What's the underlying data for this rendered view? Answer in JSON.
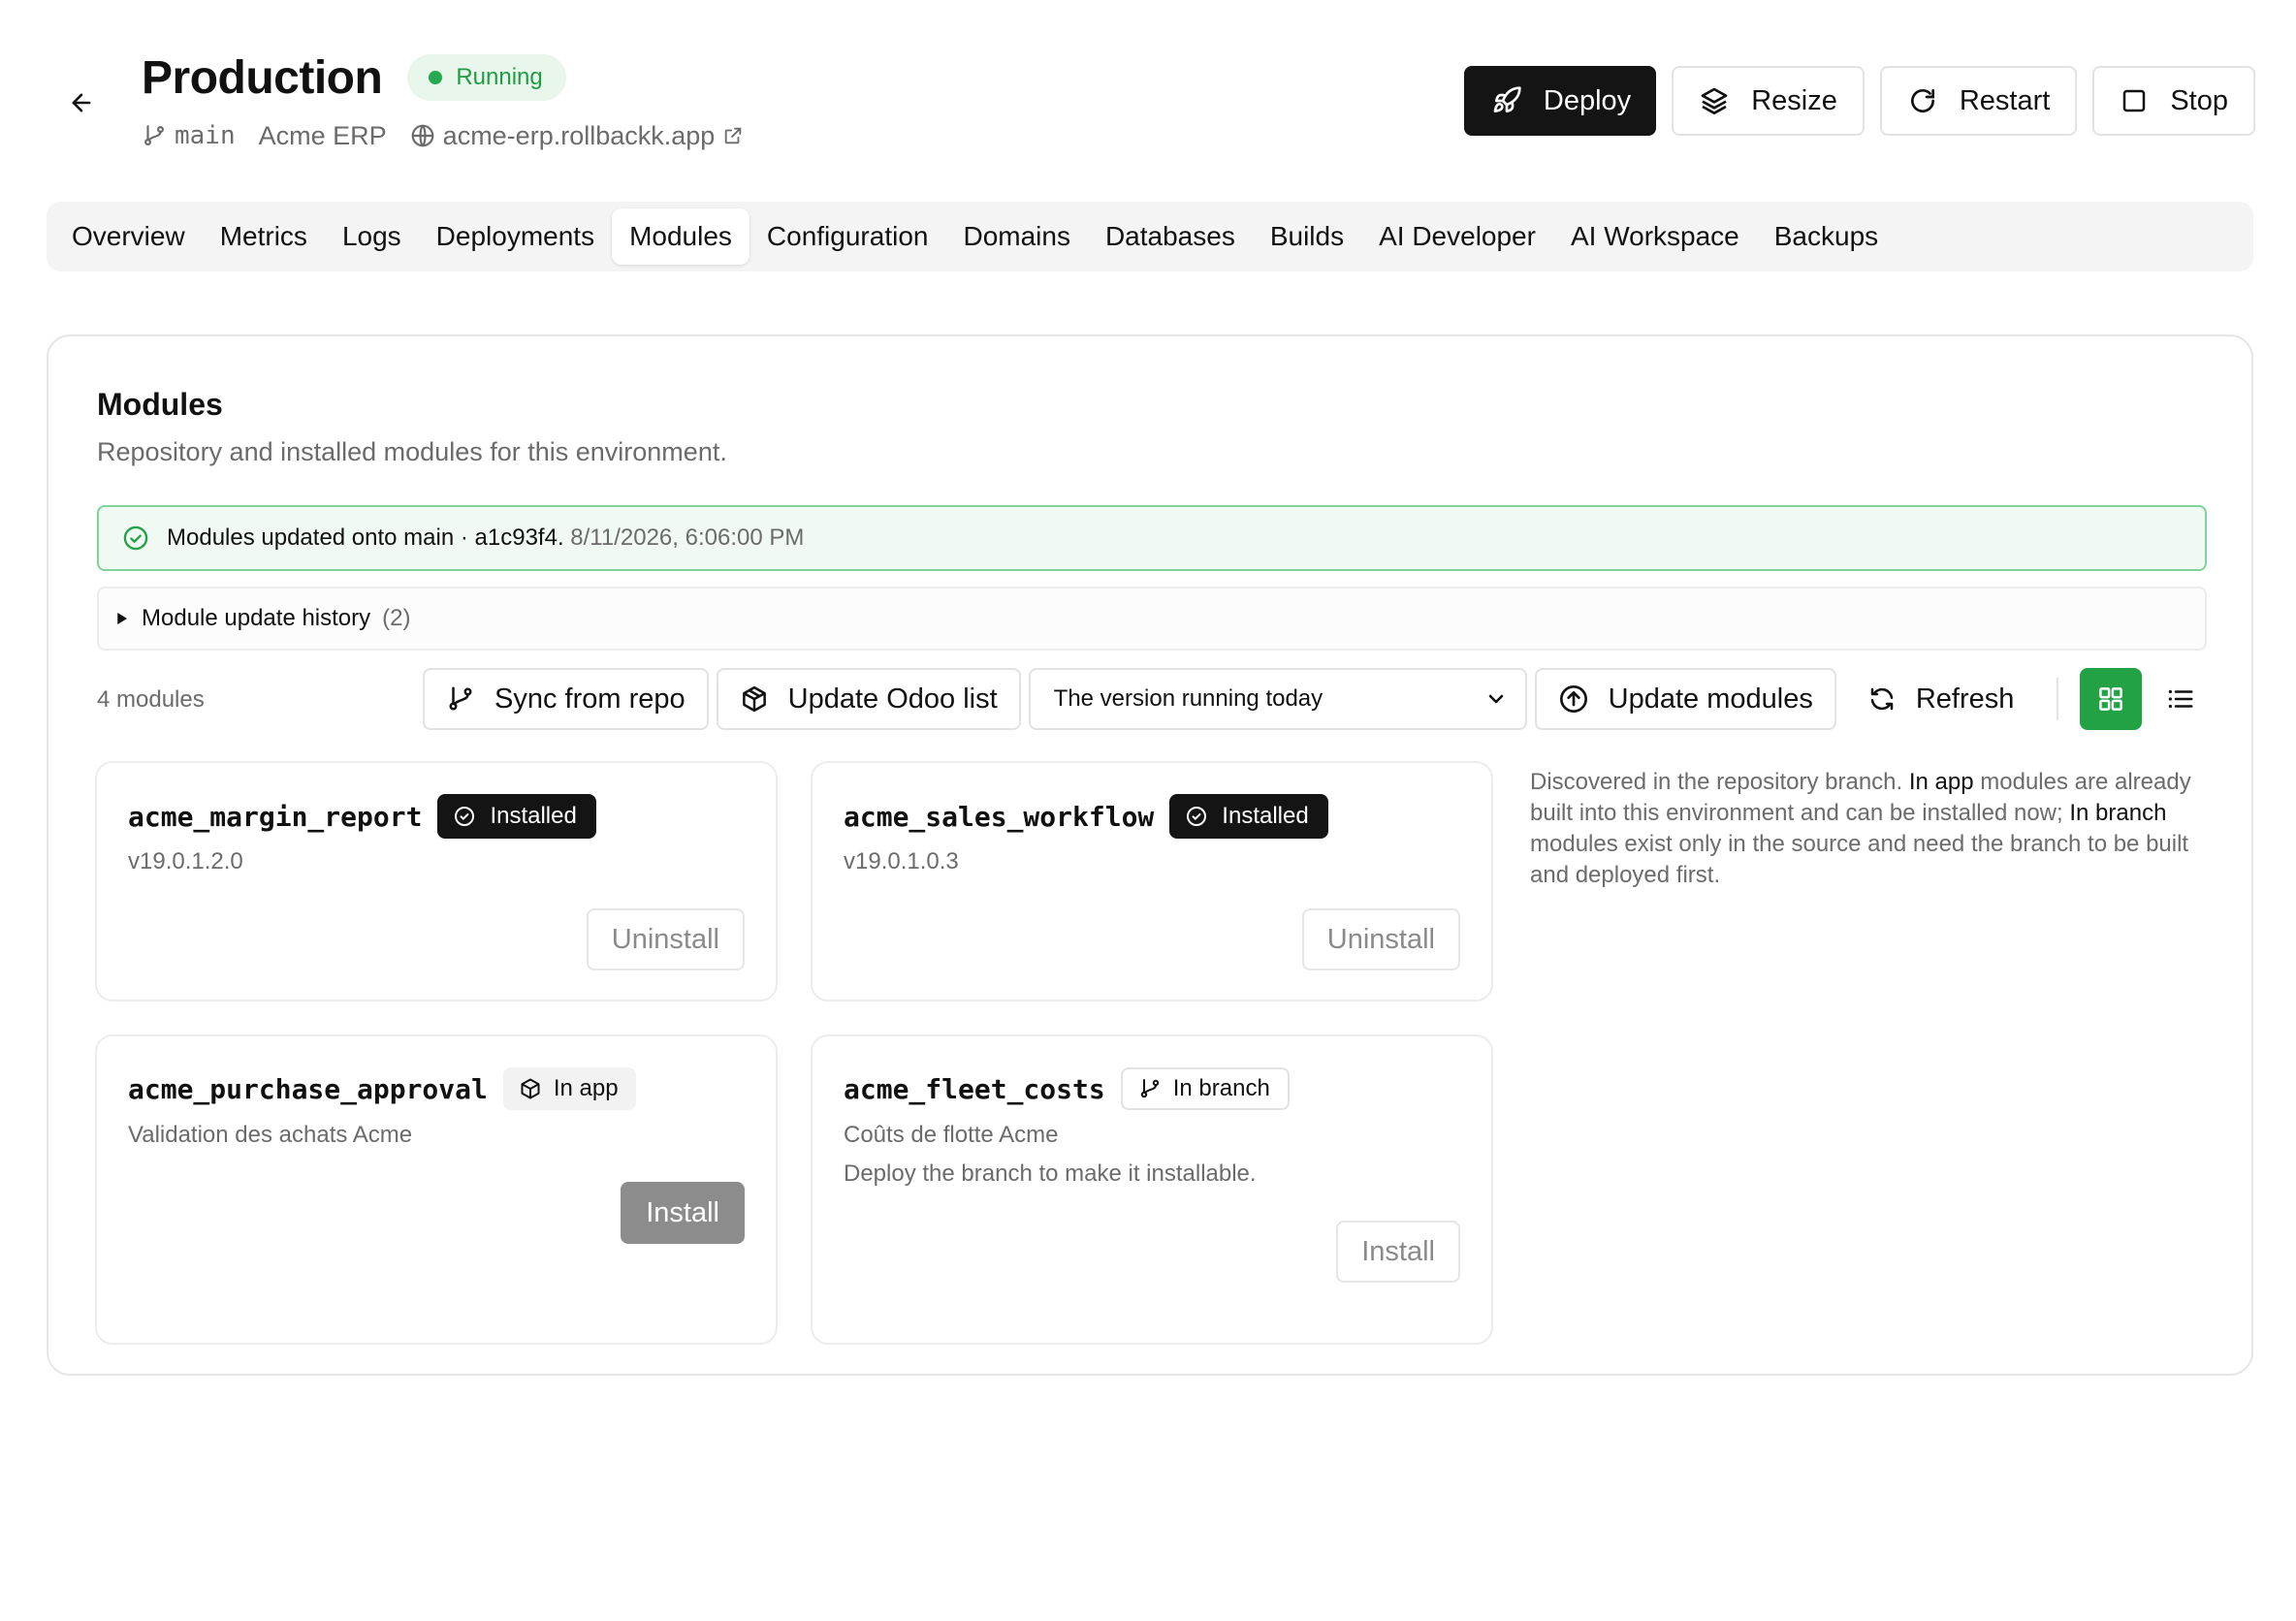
{
  "header": {
    "title": "Production",
    "status": "Running",
    "branch": "main",
    "project": "Acme ERP",
    "url": "acme-erp.rollbackk.app",
    "actions": {
      "deploy": "Deploy",
      "resize": "Resize",
      "restart": "Restart",
      "stop": "Stop"
    }
  },
  "tabs": [
    "Overview",
    "Metrics",
    "Logs",
    "Deployments",
    "Modules",
    "Configuration",
    "Domains",
    "Databases",
    "Builds",
    "AI Developer",
    "AI Workspace",
    "Backups"
  ],
  "active_tab": "Modules",
  "section": {
    "title": "Modules",
    "description": "Repository and installed modules for this environment.",
    "alert": {
      "text": "Modules updated onto main · a1c93f4.",
      "timestamp": "8/11/2026, 6:06:00 PM"
    },
    "history": {
      "label": "Module update history",
      "count": "(2)"
    }
  },
  "toolbar": {
    "count": "4 modules",
    "sync": "Sync from repo",
    "update_list": "Update Odoo list",
    "version_select": "The version running today",
    "update_modules": "Update modules",
    "refresh": "Refresh"
  },
  "modules": [
    {
      "name": "acme_margin_report",
      "badge": "Installed",
      "subtitle": "v19.0.1.2.0",
      "action": "Uninstall"
    },
    {
      "name": "acme_sales_workflow",
      "badge": "Installed",
      "subtitle": "v19.0.1.0.3",
      "action": "Uninstall"
    },
    {
      "name": "acme_purchase_approval",
      "badge": "In app",
      "subtitle": "Validation des achats Acme",
      "action": "Install"
    },
    {
      "name": "acme_fleet_costs",
      "badge": "In branch",
      "subtitle": "Coûts de flotte Acme",
      "note": "Deploy the branch to make it installable.",
      "action": "Install"
    }
  ],
  "help": {
    "p1": "Discovered in the repository branch. ",
    "in_app": "In app",
    "p2": " modules are already built into this environment and can be installed now; ",
    "in_branch": "In branch",
    "p3": " modules exist only in the source and need the branch to be built and deployed first."
  },
  "colors": {
    "accent_green": "#22a245",
    "status_green": "#1f9d45",
    "dark": "#141414"
  }
}
